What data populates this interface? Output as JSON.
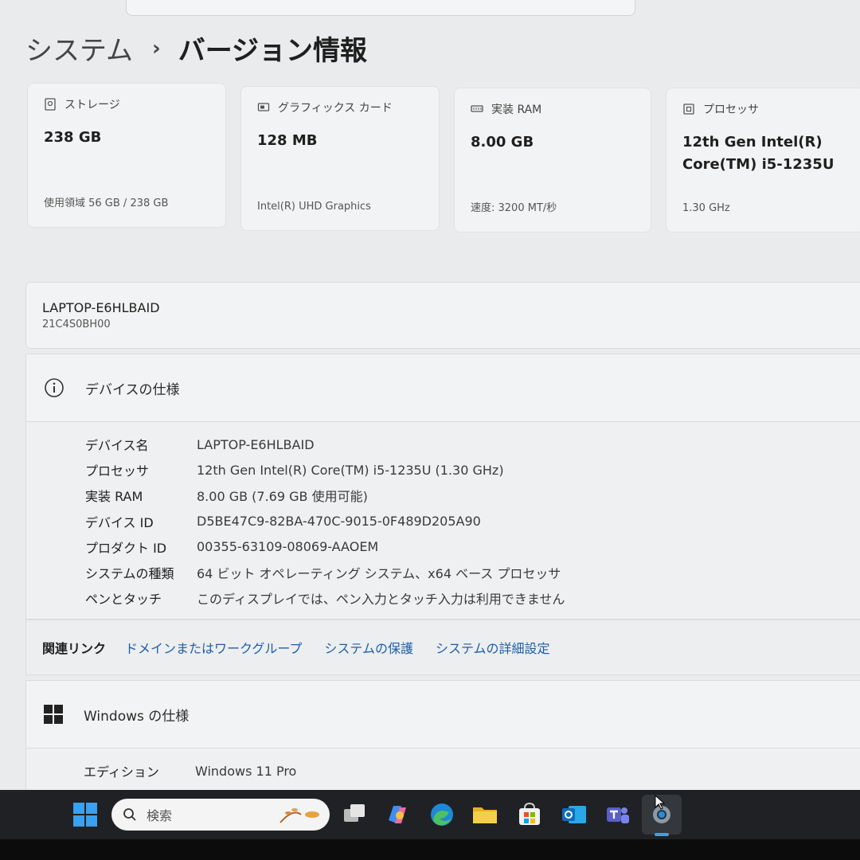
{
  "header": {
    "breadcrumb_root": "システム",
    "breadcrumb_sep": "›",
    "page_title": "バージョン情報"
  },
  "cards": [
    {
      "label": "ストレージ",
      "value": "238 GB",
      "sub": "使用領域 56 GB / 238 GB",
      "icon": "storage-icon"
    },
    {
      "label": "グラフィックス カード",
      "value": "128 MB",
      "sub": "Intel(R) UHD Graphics",
      "icon": "gpu-icon"
    },
    {
      "label": "実装 RAM",
      "value": "8.00 GB",
      "sub": "速度: 3200 MT/秒",
      "icon": "ram-icon"
    },
    {
      "label": "プロセッサ",
      "value_line1": "12th Gen Intel(R)",
      "value_line2": "Core(TM) i5-1235U",
      "sub": "1.30 GHz",
      "icon": "processor-icon"
    }
  ],
  "device": {
    "name": "LAPTOP-E6HLBAID",
    "model": "21C4S0BH00"
  },
  "device_specs": {
    "title": "デバイスの仕様",
    "rows": [
      {
        "k": "デバイス名",
        "v": "LAPTOP-E6HLBAID"
      },
      {
        "k": "プロセッサ",
        "v": "12th Gen Intel(R) Core(TM) i5-1235U (1.30 GHz)"
      },
      {
        "k": "実装 RAM",
        "v": "8.00 GB (7.69 GB 使用可能)"
      },
      {
        "k": "デバイス ID",
        "v": "D5BE47C9-82BA-470C-9015-0F489D205A90"
      },
      {
        "k": "プロダクト ID",
        "v": "00355-63109-08069-AAOEM"
      },
      {
        "k": "システムの種類",
        "v": "64 ビット オペレーティング システム、x64 ベース プロセッサ"
      },
      {
        "k": "ペンとタッチ",
        "v": "このディスプレイでは、ペン入力とタッチ入力は利用できません"
      }
    ]
  },
  "related_links": {
    "label": "関連リンク",
    "links": [
      "ドメインまたはワークグループ",
      "システムの保護",
      "システムの詳細設定"
    ]
  },
  "windows_specs": {
    "title": "Windows の仕様",
    "rows": [
      {
        "k": "エディション",
        "v": "Windows 11 Pro"
      }
    ]
  },
  "taskbar": {
    "search_placeholder": "検索",
    "apps": [
      "start-icon",
      "task-view-icon",
      "copilot-icon",
      "edge-icon",
      "file-explorer-icon",
      "store-icon",
      "outlook-icon",
      "teams-icon",
      "settings-icon"
    ]
  },
  "colors": {
    "link": "#1f5ea8",
    "taskbar": "#1f2124",
    "accent": "#0078d4"
  }
}
